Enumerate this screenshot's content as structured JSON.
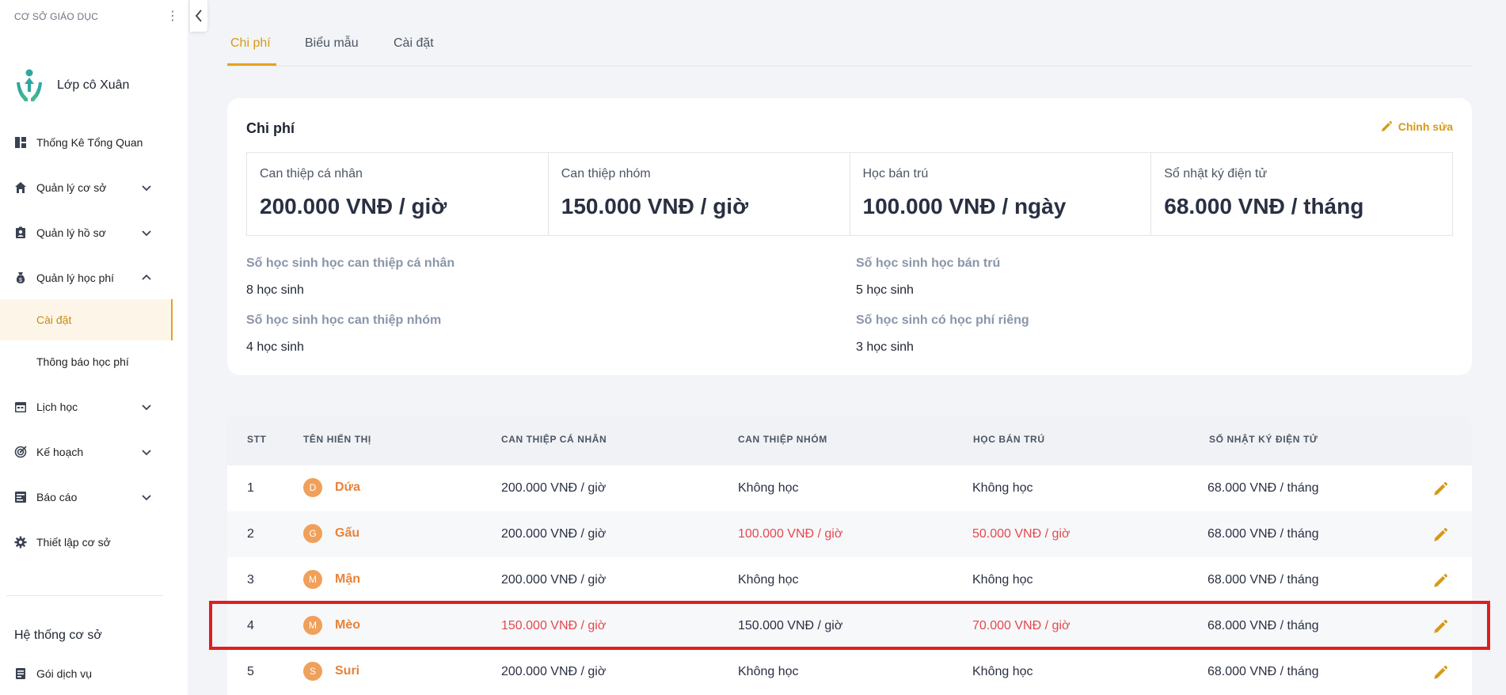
{
  "sidebar": {
    "org_type": "CƠ SỞ GIÁO DỤC",
    "org_name": "Lớp cô Xuân",
    "items": [
      {
        "label": "Thống Kê Tổng Quan",
        "icon": "dashboard-icon"
      },
      {
        "label": "Quản lý cơ sở",
        "icon": "home-icon"
      },
      {
        "label": "Quản lý hồ sơ",
        "icon": "profile-icon"
      },
      {
        "label": "Quản lý học phí",
        "icon": "money-bag-icon"
      },
      {
        "label": "Cài đặt"
      },
      {
        "label": "Thông báo học phí"
      },
      {
        "label": "Lịch học",
        "icon": "calendar-icon"
      },
      {
        "label": "Kế hoạch",
        "icon": "target-icon"
      },
      {
        "label": "Báo cáo",
        "icon": "report-icon"
      },
      {
        "label": "Thiết lập cơ sở",
        "icon": "gear-icon"
      }
    ],
    "section_title": "Hệ thống cơ sở",
    "bottom_item": {
      "label": "Gói dịch vụ",
      "icon": "package-icon"
    }
  },
  "tabs": [
    {
      "label": "Chi phí",
      "active": true
    },
    {
      "label": "Biểu mẫu",
      "active": false
    },
    {
      "label": "Cài đặt",
      "active": false
    }
  ],
  "fee_card": {
    "title": "Chi phí",
    "edit_label": "Chỉnh sửa",
    "fees": [
      {
        "label": "Can thiệp cá nhân",
        "value": "200.000 VNĐ / giờ"
      },
      {
        "label": "Can thiệp nhóm",
        "value": "150.000 VNĐ / giờ"
      },
      {
        "label": "Học bán trú",
        "value": "100.000 VNĐ / ngày"
      },
      {
        "label": "Sổ nhật ký điện tử",
        "value": "68.000 VNĐ / tháng"
      }
    ],
    "stats": [
      {
        "label": "Số học sinh học can thiệp cá nhân",
        "value": "8 học sinh"
      },
      {
        "label": "Số học sinh học bán trú",
        "value": "5 học sinh"
      },
      {
        "label": "Số học sinh học can thiệp nhóm",
        "value": "4 học sinh"
      },
      {
        "label": "Số học sinh có học phí riêng",
        "value": "3 học sinh"
      }
    ]
  },
  "table": {
    "headers": [
      "STT",
      "TÊN HIỂN THỊ",
      "CAN THIỆP CÁ NHÂN",
      "CAN THIỆP NHÓM",
      "HỌC BÁN TRÚ",
      "SỔ NHẬT KÝ ĐIỆN TỬ"
    ],
    "rows": [
      {
        "stt": "1",
        "initial": "D",
        "name": "Dứa",
        "ca_nhan": "200.000 VNĐ / giờ",
        "nhom": "Không học",
        "ban_tru": "Không học",
        "nhat_ky": "68.000 VNĐ / tháng"
      },
      {
        "stt": "2",
        "initial": "G",
        "name": "Gấu",
        "ca_nhan": "200.000 VNĐ / giờ",
        "nhom": "100.000 VNĐ / giờ",
        "ban_tru": "50.000 VNĐ / giờ",
        "nhat_ky": "68.000 VNĐ / tháng"
      },
      {
        "stt": "3",
        "initial": "M",
        "name": "Mận",
        "ca_nhan": "200.000 VNĐ / giờ",
        "nhom": "Không học",
        "ban_tru": "Không học",
        "nhat_ky": "68.000 VNĐ / tháng"
      },
      {
        "stt": "4",
        "initial": "M",
        "name": "Mèo",
        "ca_nhan": "150.000 VNĐ / giờ",
        "nhom": "150.000 VNĐ / giờ",
        "ban_tru": "70.000 VNĐ / giờ",
        "nhat_ky": "68.000 VNĐ / tháng"
      },
      {
        "stt": "5",
        "initial": "S",
        "name": "Suri",
        "ca_nhan": "200.000 VNĐ / giờ",
        "nhom": "Không học",
        "ban_tru": "Không học",
        "nhat_ky": "68.000 VNĐ / tháng"
      }
    ]
  },
  "colors": {
    "accent": "#e5a21c",
    "custom_fee_red": "#e5484d",
    "name_orange": "#e8833a",
    "highlight_box": "#e01e1e"
  }
}
